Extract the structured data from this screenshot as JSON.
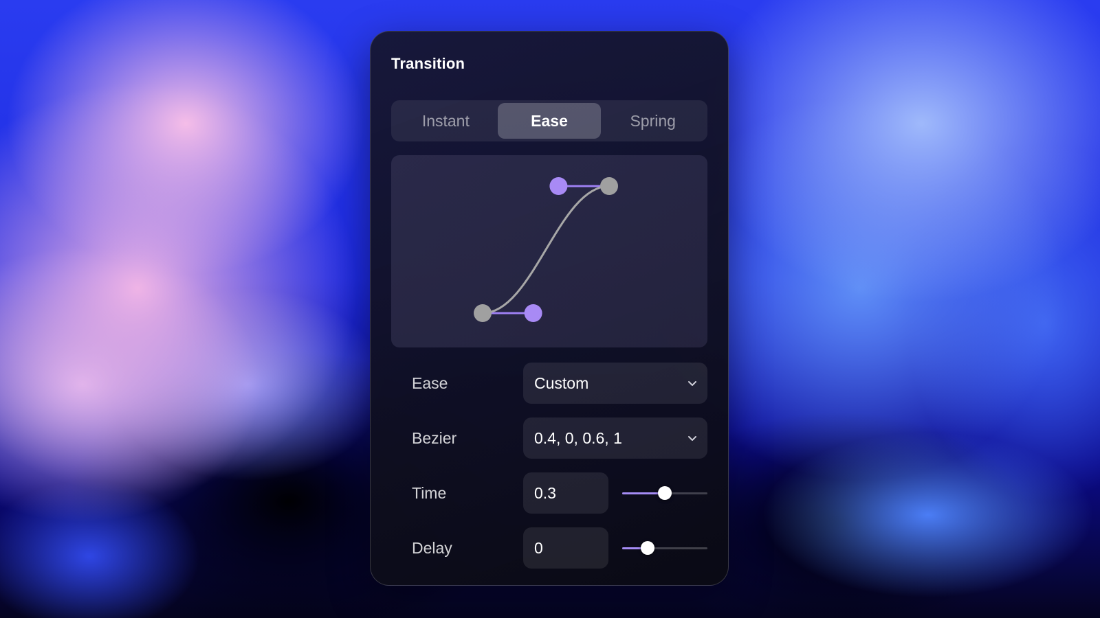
{
  "panel": {
    "title": "Transition"
  },
  "tabs": [
    {
      "label": "Instant",
      "active": false
    },
    {
      "label": "Ease",
      "active": true
    },
    {
      "label": "Spring",
      "active": false
    }
  ],
  "curve_editor": {
    "control_points": [
      0.4,
      0,
      0.6,
      1
    ],
    "colors": {
      "curve": "#a7a7a7",
      "handle_line": "#9d7ff2",
      "handle_point": "#a88af5",
      "anchor_point": "#a0a0a0"
    }
  },
  "fields": {
    "ease": {
      "label": "Ease",
      "value": "Custom",
      "icon": "chevron-down-icon"
    },
    "bezier": {
      "label": "Bezier",
      "value": "0.4, 0, 0.6, 1",
      "icon": "chevron-down-icon"
    },
    "time": {
      "label": "Time",
      "value": "0.3",
      "slider_fraction": 0.5
    },
    "delay": {
      "label": "Delay",
      "value": "0",
      "slider_fraction": 0.3
    }
  },
  "colors": {
    "accent": "#a58cf5",
    "panel_bg": "#141428"
  }
}
